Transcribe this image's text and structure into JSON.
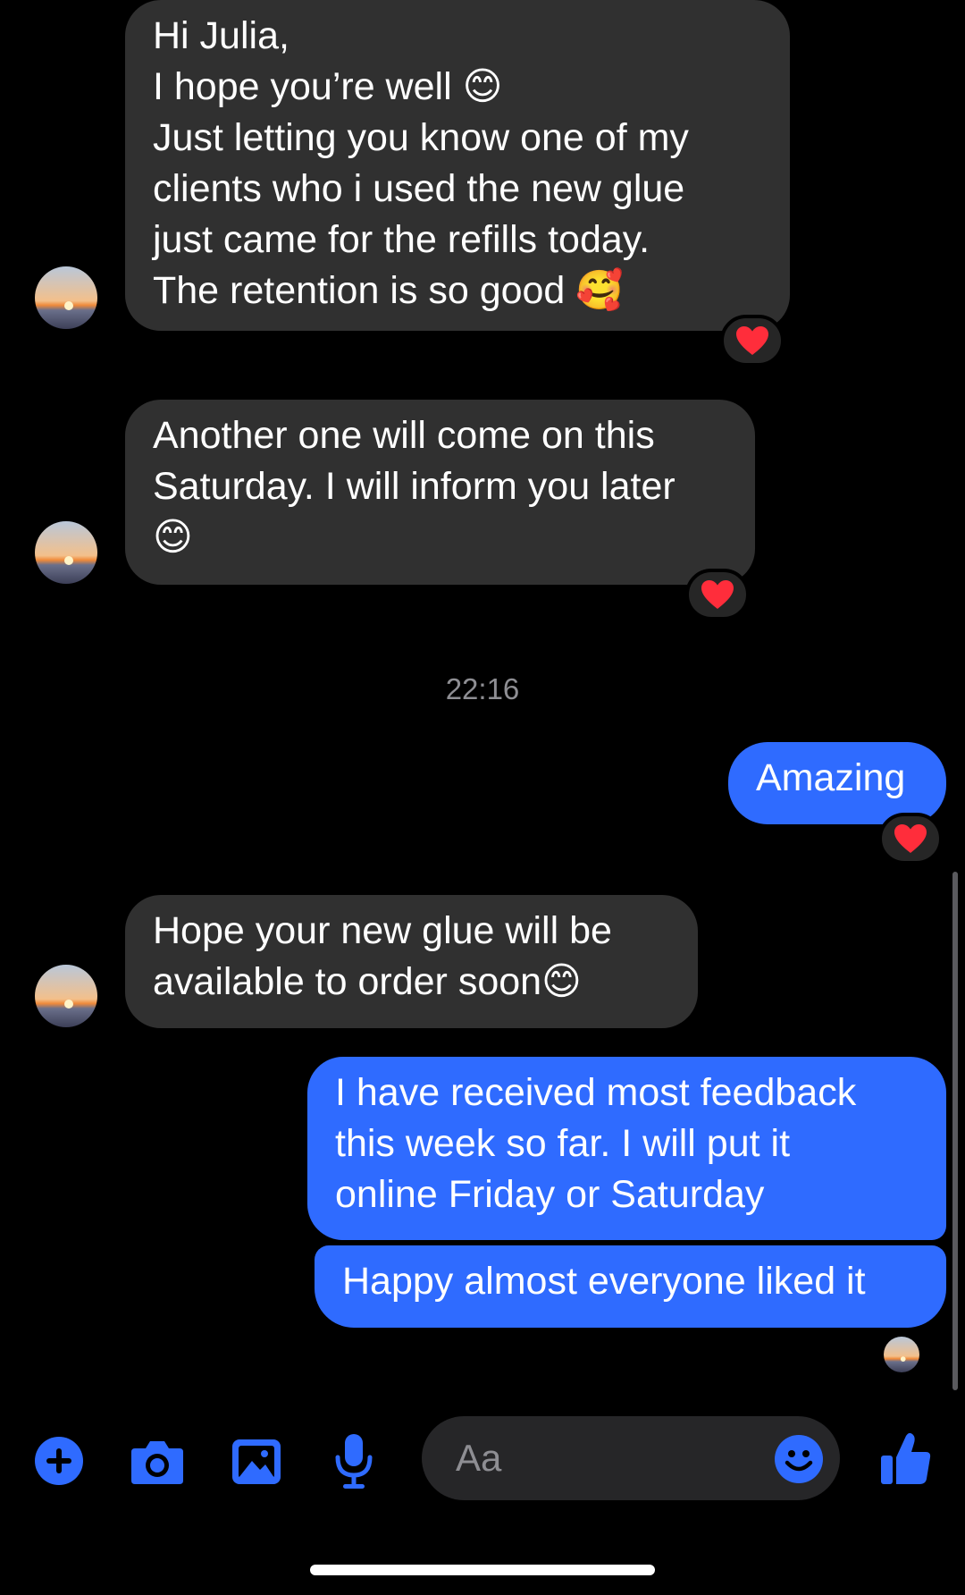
{
  "colors": {
    "accent": "#2f6bff",
    "incoming_bubble": "#303030",
    "background": "#000000",
    "icon_blue": "#2f6bff"
  },
  "messages": [
    {
      "direction": "incoming",
      "text": "Hi Julia,\nI hope you’re well 😊\nJust letting you know one of my\nclients who i used the new glue\njust came for the refills today.\nThe retention is so good 🥰",
      "reaction": "❤️"
    },
    {
      "direction": "incoming",
      "text": "Another one will come on this\nSaturday. I will inform you later\n😊",
      "reaction": "❤️"
    },
    {
      "direction": "outgoing",
      "text": "Amazing",
      "reaction": "❤️"
    },
    {
      "direction": "incoming",
      "text": "Hope your new glue will be\navailable to order soon😊"
    },
    {
      "direction": "outgoing",
      "text": "I have received most feedback\nthis week so far. I will put it\nonline Friday or Saturday"
    },
    {
      "direction": "outgoing",
      "text": "Happy almost everyone liked it"
    }
  ],
  "timestamp": "22:16",
  "composer": {
    "placeholder": "Aa"
  },
  "toolbar": {
    "icons": [
      "plus-icon",
      "camera-icon",
      "image-icon",
      "microphone-icon",
      "emoji-icon",
      "thumbs-up-icon"
    ]
  }
}
